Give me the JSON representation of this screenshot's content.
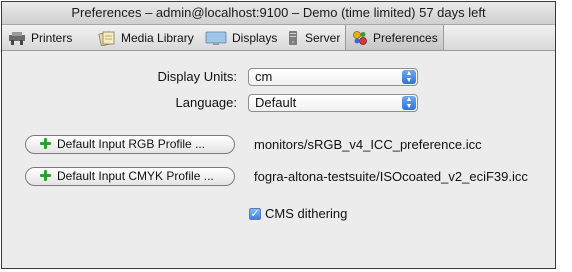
{
  "window": {
    "title": "Preferences – admin@localhost:9100 – Demo (time limited) 57 days left"
  },
  "toolbar": {
    "tabs": [
      {
        "label": "Printers",
        "icon": "printer-icon"
      },
      {
        "label": "Media Library",
        "icon": "media-library-icon"
      },
      {
        "label": "Displays",
        "icon": "display-icon"
      },
      {
        "label": "Server",
        "icon": "server-icon"
      },
      {
        "label": "Preferences",
        "icon": "preferences-icon",
        "active": true
      }
    ]
  },
  "form": {
    "display_units": {
      "label": "Display Units:",
      "value": "cm"
    },
    "language": {
      "label": "Language:",
      "value": "Default"
    },
    "rgb_profile": {
      "button_label": "Default Input RGB Profile ...",
      "path": "monitors/sRGB_v4_ICC_preference.icc"
    },
    "cmyk_profile": {
      "button_label": "Default Input CMYK Profile ...",
      "path": "fogra-altona-testsuite/ISOcoated_v2_eciF39.icc"
    },
    "cms_dithering": {
      "label": "CMS dithering",
      "checked": true
    }
  },
  "colors": {
    "accent": "#3c82dc",
    "plus_green": "#2ea02e"
  }
}
